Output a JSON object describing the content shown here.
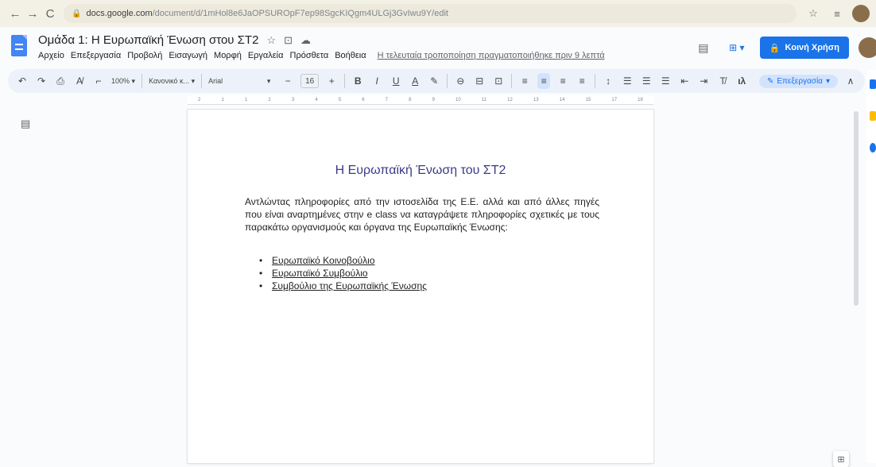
{
  "browser": {
    "url_host": "docs.google.com",
    "url_path": "/document/d/1mHol8e6JaOPSUROpF7ep98SgcKIQgm4ULGj3GvIwu9Y/edit"
  },
  "doc": {
    "title": "Ομάδα 1: Η Ευρωπαϊκή Ένωση στου ΣΤ2",
    "menus": [
      "Αρχείο",
      "Επεξεργασία",
      "Προβολή",
      "Εισαγωγή",
      "Μορφή",
      "Εργαλεία",
      "Πρόσθετα",
      "Βοήθεια"
    ],
    "last_edit": "Η τελευταία τροποποίηση πραγματοποιήθηκε πριν 9 λεπτά",
    "share_label": "Κοινή Χρήση"
  },
  "toolbar": {
    "zoom": "100%",
    "style": "Κανονικό κ...",
    "font": "Arial",
    "font_size": "16",
    "mode_label": "Επεξεργασία"
  },
  "ruler": {
    "ticks": [
      "2",
      "1",
      "1",
      "2",
      "3",
      "4",
      "5",
      "6",
      "7",
      "8",
      "9",
      "10",
      "11",
      "12",
      "13",
      "14",
      "15",
      "17",
      "18"
    ]
  },
  "content": {
    "heading": "Η Ευρωπαϊκή Ένωση του ΣΤ2",
    "paragraph": "Αντλώντας πληροφορίες από την ιστοσελίδα της Ε.Ε. αλλά και από άλλες πηγές που είναι αναρτημένες στην e class να καταγράψετε πληροφορίες σχετικές με τους παρακάτω οργανισμούς και όργανα της Ευρωπαϊκής Ένωσης:",
    "list": [
      "Ευρωπαϊκό Κοινοβούλιο",
      "Ευρωπαϊκό Συμβούλιο",
      "Συμβούλιο της Ευρωπαϊκής Ένωσης"
    ]
  },
  "colors": {
    "accent": "#1a73e8",
    "heading": "#3b3b8a"
  }
}
